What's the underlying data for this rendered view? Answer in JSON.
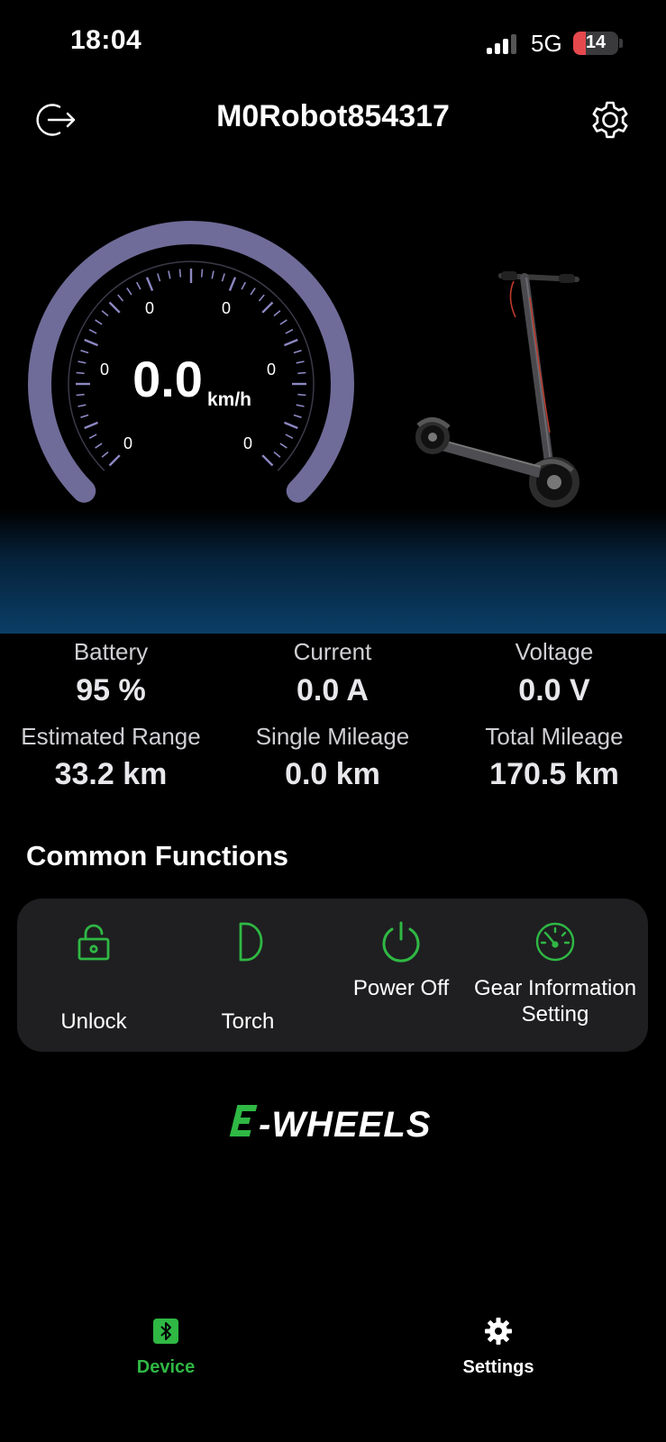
{
  "status_bar": {
    "time": "18:04",
    "network": "5G",
    "battery": "14"
  },
  "header": {
    "title": "M0Robot854317",
    "logout_icon": "logout-icon",
    "settings_icon": "gear-icon"
  },
  "speedometer": {
    "speed": "0.0",
    "unit": "km/h",
    "tick_labels": [
      "0",
      "0",
      "0",
      "0",
      "0",
      "0"
    ],
    "arc_color": "#6f6c99"
  },
  "scooter_image": "electric-scooter",
  "stats": [
    {
      "label": "Battery",
      "value": "95 %"
    },
    {
      "label": "Current",
      "value": "0.0 A"
    },
    {
      "label": "Voltage",
      "value": "0.0 V"
    },
    {
      "label": "Estimated Range",
      "value": "33.2 km"
    },
    {
      "label": "Single Mileage",
      "value": "0.0 km"
    },
    {
      "label": "Total Mileage",
      "value": "170.5 km"
    }
  ],
  "common_functions": {
    "title": "Common Functions",
    "items": [
      {
        "label": "Unlock",
        "icon": "unlock-icon"
      },
      {
        "label": "Torch",
        "icon": "torch-icon"
      },
      {
        "label": "Power Off",
        "icon": "power-icon"
      },
      {
        "label": "Gear Information Setting",
        "icon": "speedometer-icon"
      }
    ],
    "accent_color": "#2fb844"
  },
  "brand": {
    "logo_text": "E-WHEELS",
    "accent_color": "#2fb844"
  },
  "bottom_nav": {
    "items": [
      {
        "label": "Device",
        "icon": "bluetooth-icon",
        "active": true
      },
      {
        "label": "Settings",
        "icon": "gear-icon",
        "active": false
      }
    ],
    "active_color": "#2fb844"
  }
}
